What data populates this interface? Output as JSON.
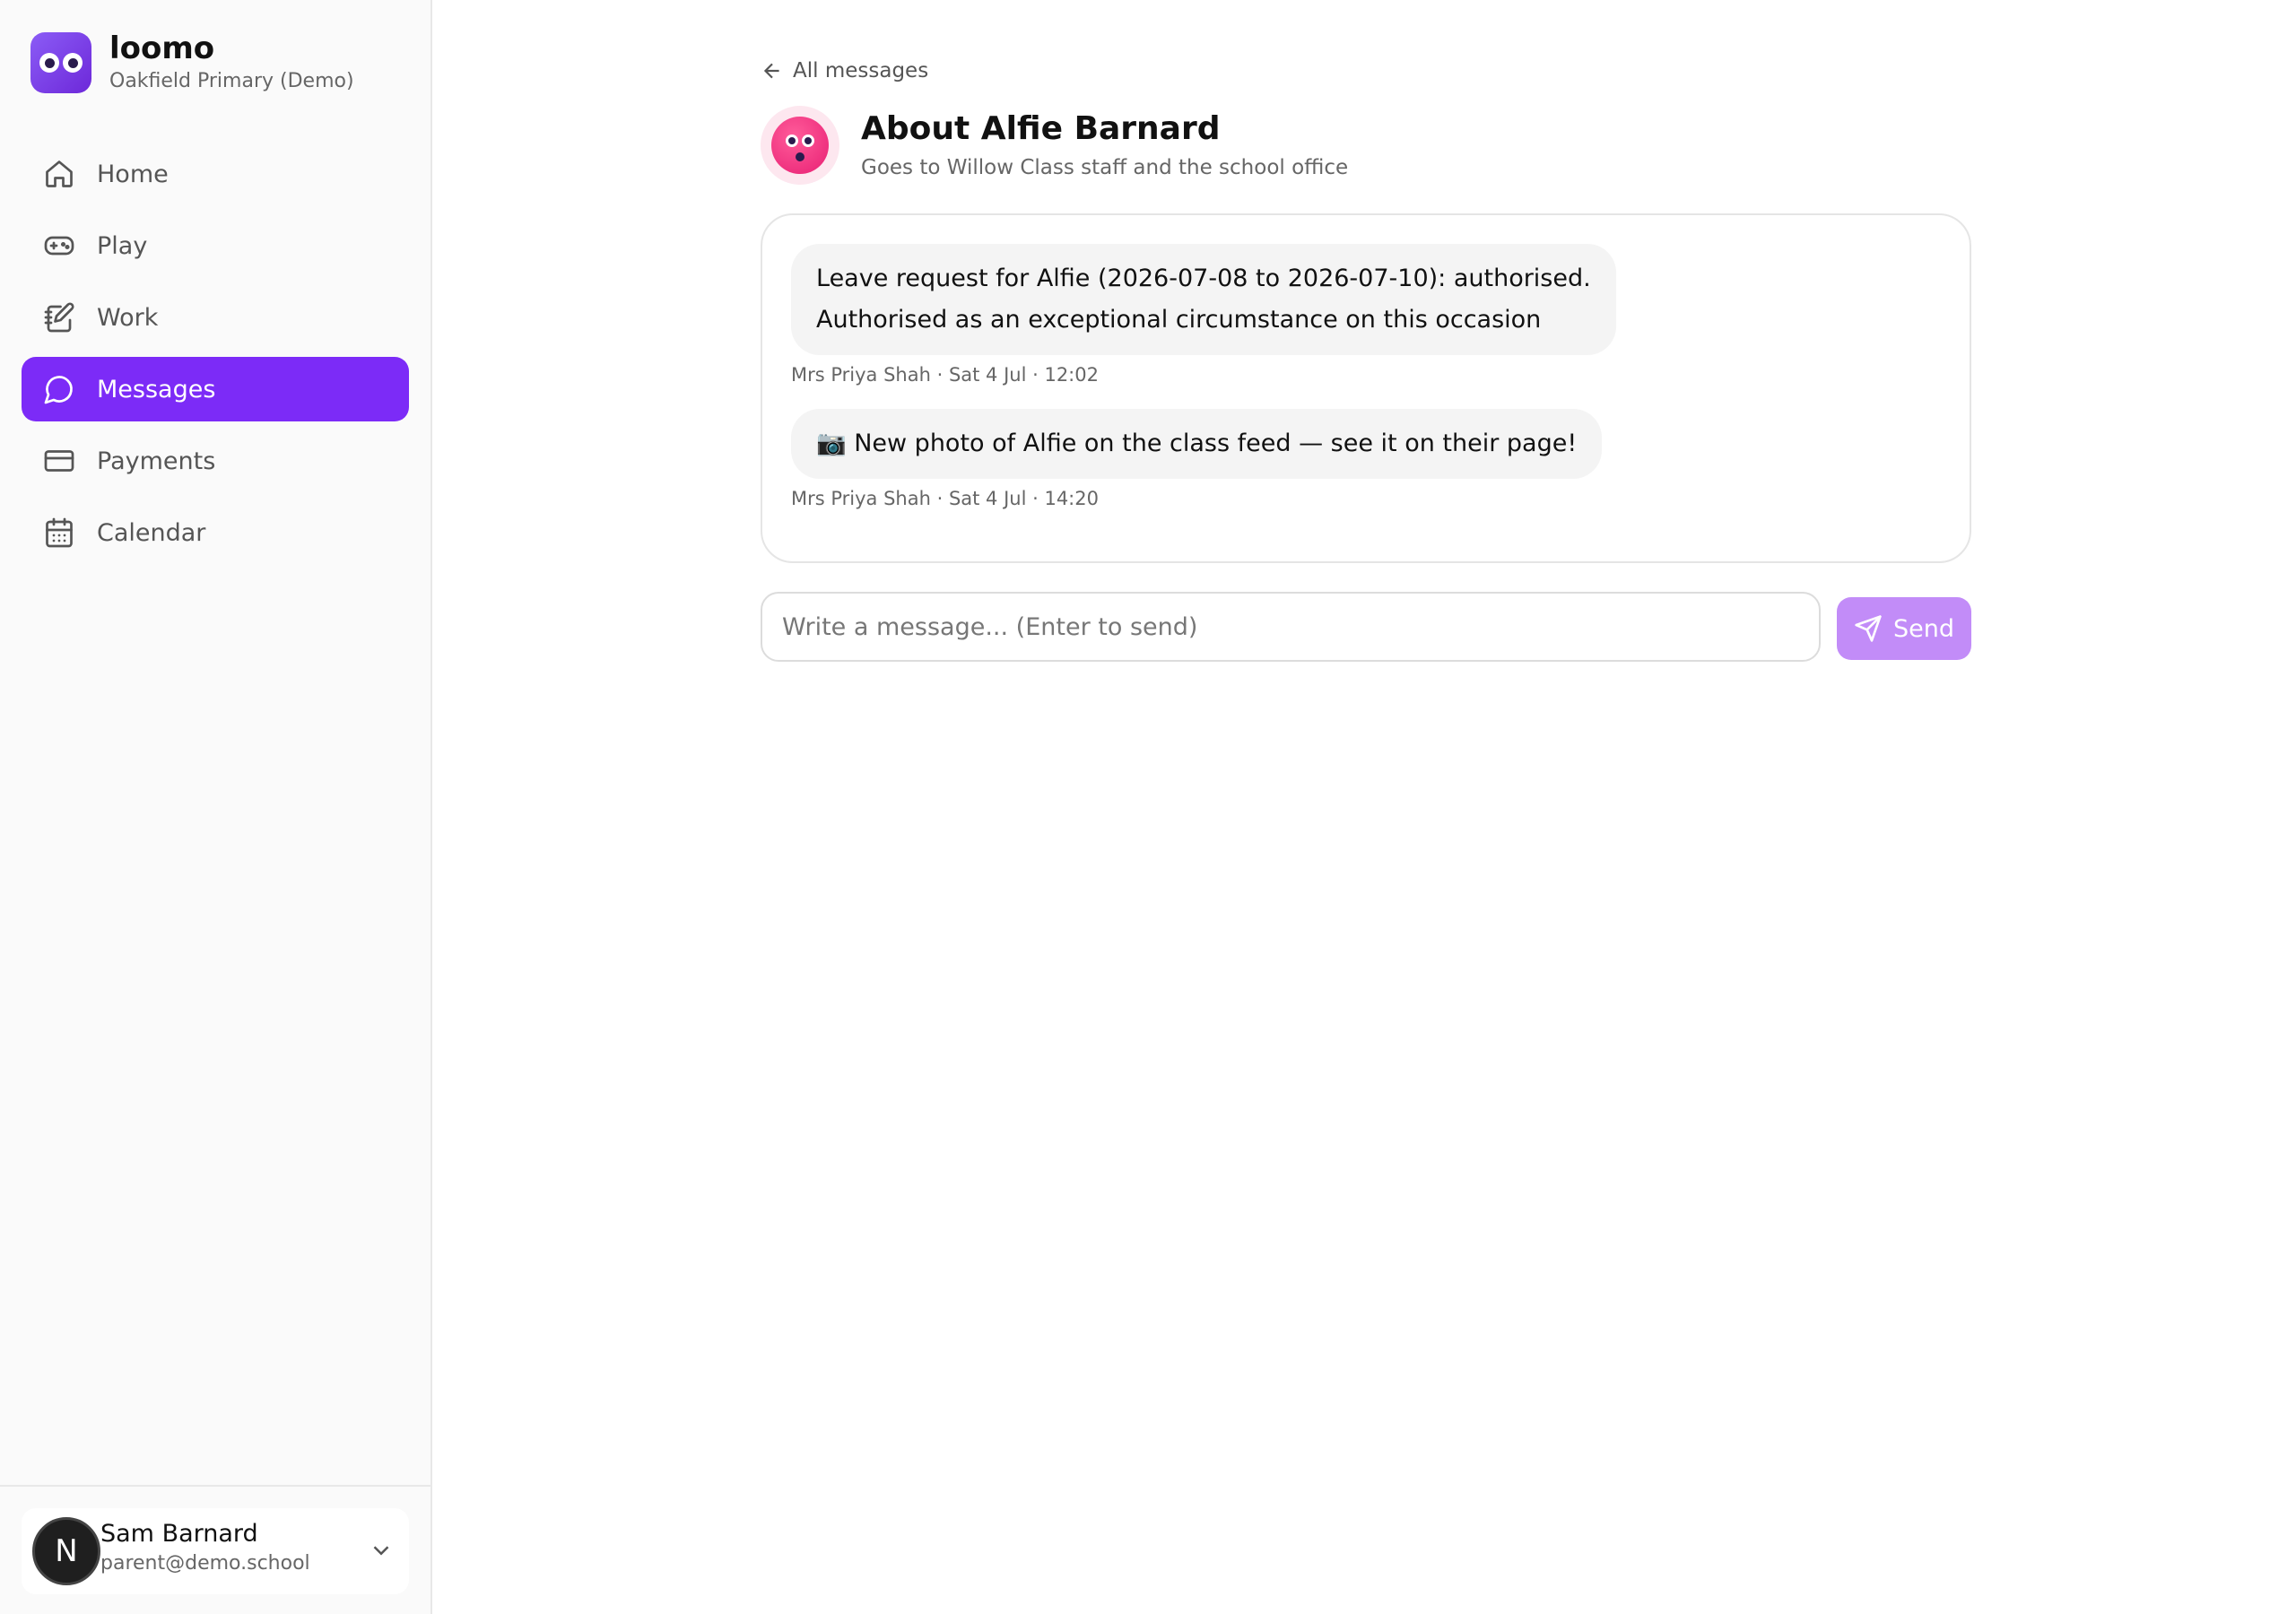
{
  "brand": {
    "name": "loomo",
    "school": "Oakfield Primary (Demo)",
    "accent": "#7c2bf7"
  },
  "nav": {
    "items": [
      {
        "label": "Home",
        "icon": "home-icon"
      },
      {
        "label": "Play",
        "icon": "gamepad-icon"
      },
      {
        "label": "Work",
        "icon": "notebook-pen-icon"
      },
      {
        "label": "Messages",
        "icon": "message-circle-icon",
        "active": true
      },
      {
        "label": "Payments",
        "icon": "credit-card-icon"
      },
      {
        "label": "Calendar",
        "icon": "calendar-icon"
      }
    ]
  },
  "user": {
    "initial": "N",
    "name": "Sam Barnard",
    "email": "parent@demo.school"
  },
  "conversation": {
    "back_label": "All messages",
    "title": "About Alfie Barnard",
    "subtitle": "Goes to Willow Class staff and the school office",
    "messages": [
      {
        "line1": "Leave request for Alfie (2026-07-08 to 2026-07-10): authorised.",
        "line2": "Authorised as an exceptional circumstance on this occasion",
        "meta": "Mrs Priya Shah · Sat 4 Jul · 12:02"
      },
      {
        "text": "📷 New photo of Alfie on the class feed — see it on their page!",
        "meta": "Mrs Priya Shah · Sat 4 Jul · 14:20"
      }
    ]
  },
  "composer": {
    "placeholder": "Write a message... (Enter to send)",
    "value": "",
    "send_label": "Send"
  }
}
